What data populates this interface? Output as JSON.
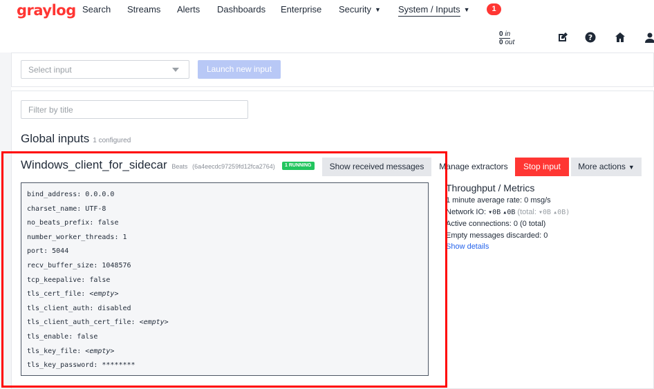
{
  "nav": {
    "logo": "graylog",
    "items": [
      {
        "label": "Search"
      },
      {
        "label": "Streams"
      },
      {
        "label": "Alerts"
      },
      {
        "label": "Dashboards"
      },
      {
        "label": "Enterprise"
      },
      {
        "label": "Security"
      },
      {
        "label": "System / Inputs"
      }
    ],
    "notification_count": "1"
  },
  "header": {
    "throughput_in": "0",
    "throughput_in_label": "in",
    "throughput_out": "0",
    "throughput_out_label": "out",
    "icons": [
      "edit-icon",
      "help-icon",
      "home-icon",
      "user-icon"
    ]
  },
  "launch": {
    "select_placeholder": "Select input",
    "button_label": "Launch new input"
  },
  "filter": {
    "placeholder": "Filter by title"
  },
  "global_inputs": {
    "title": "Global inputs",
    "count_label": "1 configured"
  },
  "input": {
    "title": "Windows_client_for_sidecar",
    "type": "Beats",
    "id": "(6a4eecdc97259fd12fca2764)",
    "status_badge": "1 RUNNING",
    "actions": {
      "show_messages": "Show received messages",
      "manage_extractors": "Manage extractors",
      "stop": "Stop input",
      "more": "More actions"
    },
    "config": [
      {
        "key": "bind_address",
        "value": "0.0.0.0",
        "empty": false
      },
      {
        "key": "charset_name",
        "value": "UTF-8",
        "empty": false
      },
      {
        "key": "no_beats_prefix",
        "value": "false",
        "empty": false
      },
      {
        "key": "number_worker_threads",
        "value": "1",
        "empty": false
      },
      {
        "key": "port",
        "value": "5044",
        "empty": false
      },
      {
        "key": "recv_buffer_size",
        "value": "1048576",
        "empty": false
      },
      {
        "key": "tcp_keepalive",
        "value": "false",
        "empty": false
      },
      {
        "key": "tls_cert_file",
        "value": "<empty>",
        "empty": true
      },
      {
        "key": "tls_client_auth",
        "value": "disabled",
        "empty": false
      },
      {
        "key": "tls_client_auth_cert_file",
        "value": "<empty>",
        "empty": true
      },
      {
        "key": "tls_enable",
        "value": "false",
        "empty": false
      },
      {
        "key": "tls_key_file",
        "value": "<empty>",
        "empty": true
      },
      {
        "key": "tls_key_password",
        "value": "********",
        "empty": false
      }
    ]
  },
  "metrics": {
    "title": "Throughput / Metrics",
    "avg_rate_label": "1 minute average rate:",
    "avg_rate_value": "0 msg/s",
    "network_io_label": "Network IO:",
    "network_in": "0B",
    "network_out": "0B",
    "total_label": "(total:",
    "total_in": "0B",
    "total_out": "0B)",
    "active_connections_label": "Active connections:",
    "active_connections_value": "0 (0 total)",
    "empty_discarded_label": "Empty messages discarded:",
    "empty_discarded_value": "0",
    "show_details": "Show details"
  },
  "colors": {
    "brand": "#ff3633",
    "highlight_border": "#ff0000",
    "running_badge": "#22c55e",
    "launch_button": "#b8c8f6",
    "link": "#2563eb"
  }
}
